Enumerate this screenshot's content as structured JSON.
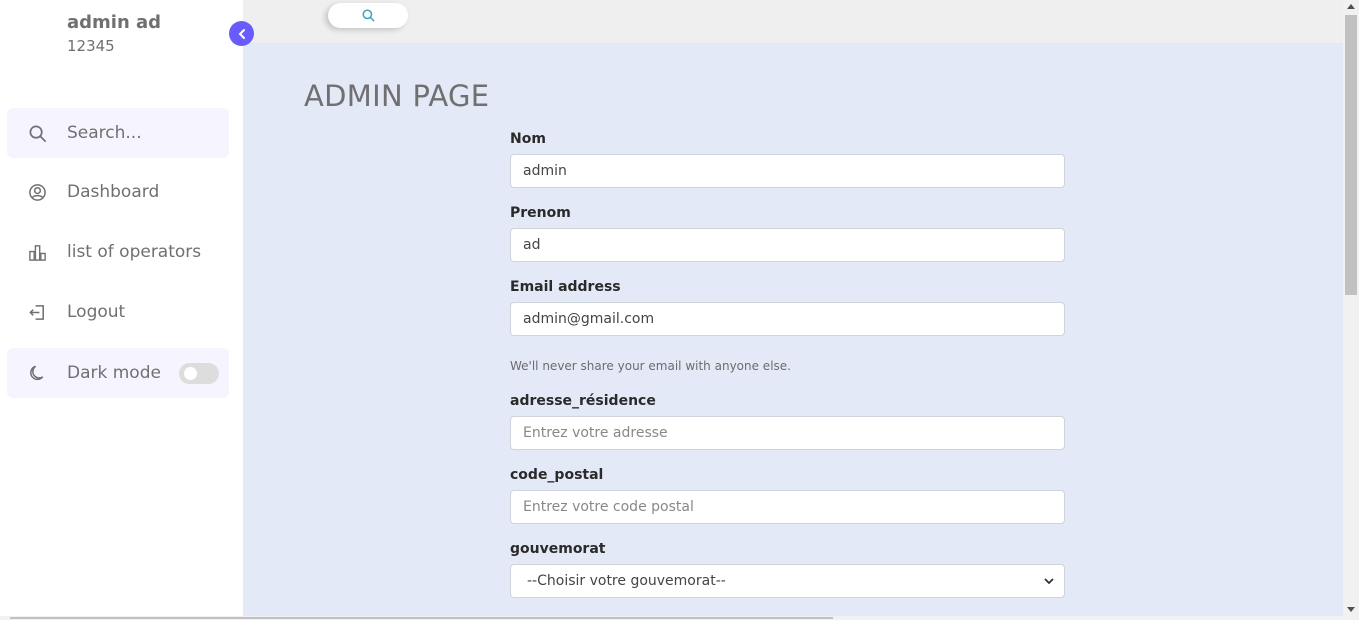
{
  "sidebar": {
    "user_name": "admin ad",
    "user_id": "12345",
    "search_label": "Search...",
    "items": [
      {
        "label": "Dashboard",
        "icon": "user-circle-icon"
      },
      {
        "label": "list of operators",
        "icon": "bar-chart-icon"
      },
      {
        "label": "Logout",
        "icon": "logout-icon"
      }
    ],
    "dark_mode_label": "Dark mode",
    "dark_mode_on": false
  },
  "topbar": {
    "search_icon": "search-icon"
  },
  "main": {
    "title": "ADMIN PAGE",
    "fields": {
      "nom": {
        "label": "Nom",
        "value": "admin"
      },
      "prenom": {
        "label": "Prenom",
        "value": "ad"
      },
      "email": {
        "label": "Email address",
        "value": "admin@gmail.com",
        "hint": "We'll never share your email with anyone else."
      },
      "adresse": {
        "label": "adresse_résidence",
        "placeholder": "Entrez votre adresse"
      },
      "code_postal": {
        "label": "code_postal",
        "placeholder": "Entrez votre code postal"
      },
      "gouvernorat": {
        "label": "gouvemorat",
        "selected": "--Choisir votre gouvemorat--"
      }
    }
  },
  "colors": {
    "accent": "#695cfe",
    "background": "#e4e9f7",
    "sidebar": "#ffffff",
    "text": "#707070"
  }
}
